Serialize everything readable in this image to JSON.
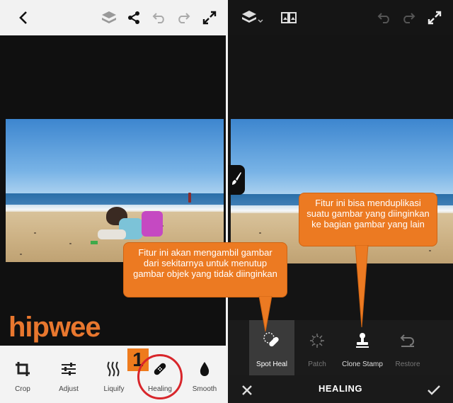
{
  "left_panel": {
    "logo_text": "hipwee",
    "tools": [
      {
        "label": "Crop",
        "icon": "crop-icon"
      },
      {
        "label": "Adjust",
        "icon": "sliders-icon"
      },
      {
        "label": "Liquify",
        "icon": "liquify-icon"
      },
      {
        "label": "Healing",
        "icon": "bandage-icon"
      },
      {
        "label": "Smooth",
        "icon": "droplet-icon"
      }
    ],
    "step_badge": "1",
    "callout": "Fitur ini akan mengambil gambar dari sekitarnya untuk menutup gambar objek yang tidak diinginkan"
  },
  "right_panel": {
    "heal_tools": [
      {
        "label": "Spot Heal",
        "icon": "spot-heal-icon",
        "state": "selected"
      },
      {
        "label": "Patch",
        "icon": "patch-icon",
        "state": "disabled"
      },
      {
        "label": "Clone Stamp",
        "icon": "stamp-icon",
        "state": "enabled"
      },
      {
        "label": "Restore",
        "icon": "restore-icon",
        "state": "disabled"
      }
    ],
    "title": "HEALING",
    "callout": "Fitur ini bisa menduplikasi suatu gambar yang diinginkan ke bagian gambar yang lain"
  },
  "colors": {
    "accent_orange": "#ec7a22",
    "highlight_red": "#d8262b",
    "logo_orange": "#e8772e"
  }
}
